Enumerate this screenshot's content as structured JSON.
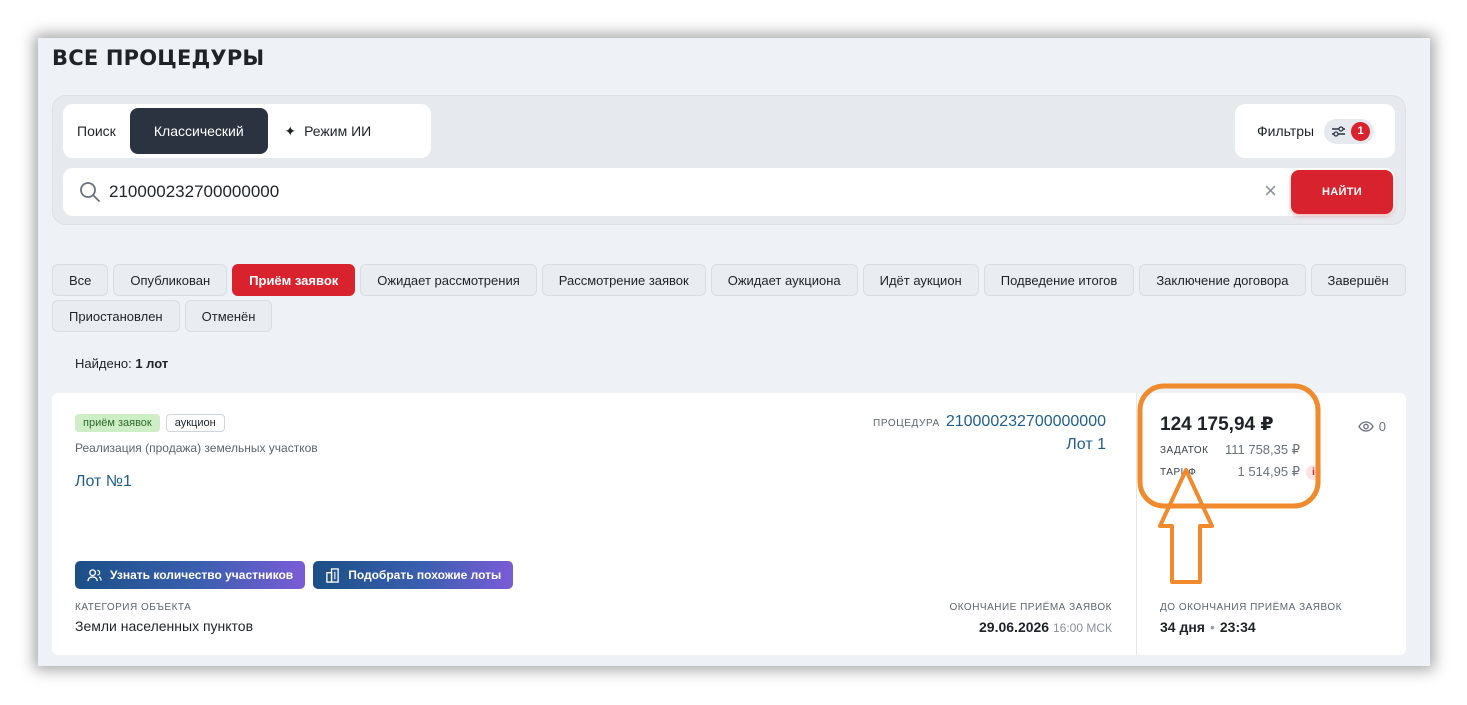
{
  "page": {
    "title": "ВСЕ ПРОЦЕДУРЫ"
  },
  "search_panel": {
    "mode_label": "Поиск",
    "mode_classic": "Классический",
    "mode_ai": "Режим ИИ",
    "filters_label": "Фильтры",
    "filters_count": "1",
    "query": "210000232700000000",
    "find_button": "НАЙТИ"
  },
  "status_chips": {
    "row1": [
      "Все",
      "Опубликован",
      "Приём заявок",
      "Ожидает рассмотрения",
      "Рассмотрение заявок",
      "Ожидает аукциона",
      "Идёт аукцион",
      "Подведение итогов",
      "Заключение договора",
      "Завершён"
    ],
    "row2": [
      "Приостановлен",
      "Отменён"
    ],
    "active": "Приём заявок"
  },
  "results": {
    "found_label": "Найдено:",
    "found_value": "1 лот"
  },
  "card": {
    "tag_status": "приём заявок",
    "tag_type": "аукцион",
    "procedure_type": "Реализация (продажа) земельных участков",
    "lot_title": "Лот №1",
    "procedure_caption": "ПРОЦЕДУРА",
    "procedure_number": "210000232700000000",
    "lot_number": "Лот 1",
    "btn_participants": "Узнать количество участников",
    "btn_similar": "Подобрать похожие лоты",
    "category_caption": "КАТЕГОРИЯ ОБЪЕКТА",
    "category_value": "Земли населенных пунктов",
    "end_caption": "ОКОНЧАНИЕ ПРИЁМА ЗАЯВОК",
    "end_date": "29.06.2026",
    "end_time": "16:00 МСК",
    "price": "124 175,94 ₽",
    "deposit_label": "ЗАДАТОК",
    "deposit_value": "111 758,35 ₽",
    "tariff_label": "ТАРИФ",
    "tariff_value": "1 514,95 ₽",
    "info_icon": "i",
    "views": "0",
    "remain_caption": "ДО ОКОНЧАНИЯ ПРИЁМА ЗАЯВОК",
    "remain_days": "34 дня",
    "remain_time": "23:34"
  },
  "colors": {
    "accent_red": "#d8232f",
    "dark_button": "#2c3340",
    "link_blue": "#1f5f8b",
    "annotation_orange": "#f08a2c"
  }
}
